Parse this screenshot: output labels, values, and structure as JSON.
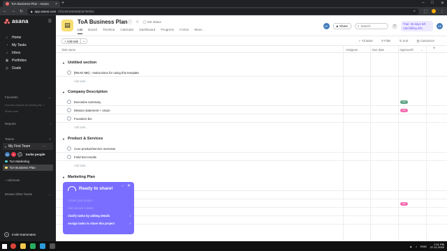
{
  "browser": {
    "tab_title": "ToA Business Plan - Asana",
    "tab_close": "×",
    "new_tab": "+",
    "url_host": "app.asana.com",
    "url_path": "/0/1199158369835780/list",
    "window_controls": [
      "–",
      "□",
      "✕"
    ]
  },
  "sidebar": {
    "logo": "asana",
    "nav": [
      {
        "label": "Home",
        "icon": "home-icon",
        "glyph": "⌂"
      },
      {
        "label": "My Tasks",
        "icon": "check-circle-icon",
        "glyph": "◔"
      },
      {
        "label": "Inbox",
        "icon": "bell-icon",
        "glyph": "♪"
      },
      {
        "label": "Portfolios",
        "icon": "portfolio-icon",
        "glyph": "▣"
      },
      {
        "label": "Goals",
        "icon": "goals-icon",
        "glyph": "◎"
      }
    ],
    "favorites_label": "Favorites",
    "favorites_note": "Favorite projects by clicking the ☆",
    "show_more": "Show more",
    "reports_label": "Reports",
    "teams_label": "Teams",
    "team_name": "My First Team",
    "invite_people": "Invite people",
    "projects": [
      {
        "name": "ToA Marketing",
        "color": "#4ecbc4",
        "active": false
      },
      {
        "name": "ToA Business Plan",
        "color": "#f8df72",
        "active": true
      }
    ],
    "add_team": "+ Add team",
    "browse_teams": "Browse Other Teams",
    "invite_teammates": "Invite teammates"
  },
  "header": {
    "project_title": "ToA Business Plan",
    "set_status": "Set status",
    "tabs": [
      "List",
      "Board",
      "Timeline",
      "Calendar",
      "Dashboard",
      "Progress",
      "Forms",
      "More..."
    ],
    "active_tab": "List",
    "share": "Share",
    "search_placeholder": "Search",
    "trial_line1": "Trial: 30 days left",
    "trial_line2": "Add billing info",
    "user_initials": "GE"
  },
  "toolbar": {
    "add_task": "+ Add task",
    "dropdown": "⌄",
    "actions": [
      "All tasks",
      "Filter",
      "Sort",
      "Customize"
    ]
  },
  "columns": {
    "task_name": "Task name",
    "assignee": "Assignee",
    "due_date": "Due date",
    "approved": "Approved?"
  },
  "sections": [
    {
      "title": "Untitled section",
      "tasks": [
        {
          "name": "[READ ME] - Instructions for using this template",
          "approved": null
        }
      ]
    },
    {
      "title": "Company Description",
      "tasks": [
        {
          "name": "Executive summary",
          "approved": {
            "label": "Yes",
            "color": "#5da283"
          }
        },
        {
          "name": "Mission statement + vision",
          "approved": {
            "label": "No",
            "color": "#f26fb2"
          }
        },
        {
          "name": "Founders bio",
          "approved": null
        }
      ]
    },
    {
      "title": "Product & Services",
      "tasks": [
        {
          "name": "Core product/service overview",
          "approved": null
        },
        {
          "name": "Field test results",
          "approved": null
        }
      ]
    },
    {
      "title": "Marketing Plan",
      "tasks": []
    }
  ],
  "add_task_link": "Add task...",
  "popup": {
    "title": "Ready to share!",
    "minimize": "–",
    "close": "✕",
    "steps": [
      {
        "label": "Create your project",
        "state": "done"
      },
      {
        "label": "Add at least 3 tasks",
        "state": "done"
      },
      {
        "label": "Clarify tasks by adding details",
        "state": "active"
      },
      {
        "label": "Assign tasks to share this project",
        "state": "active"
      }
    ],
    "arrow": "›"
  },
  "marketing_pill": {
    "label": "No",
    "color": "#f26fb2"
  },
  "taskbar": {
    "time": "2:11 PM",
    "date": "27-11-2020",
    "lang": "ENG"
  }
}
